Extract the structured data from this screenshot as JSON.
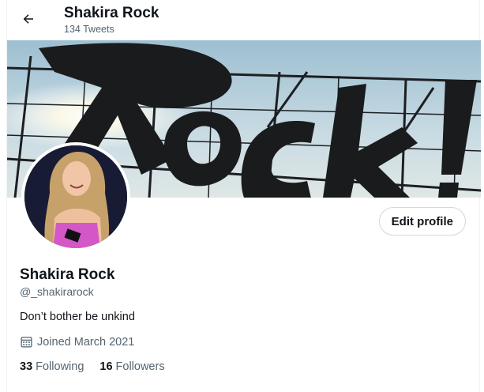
{
  "header": {
    "title": "Shakira Rock",
    "tweet_count": "134 Tweets",
    "back_icon": "arrow-left-icon"
  },
  "profile": {
    "name": "Shakira Rock",
    "handle": "@_shakirarock",
    "bio": "Don’t bother be unkind",
    "joined": "Joined March 2021",
    "following_count": "33",
    "following_label": "Following",
    "followers_count": "16",
    "followers_label": "Followers",
    "calendar_icon": "calendar-icon"
  },
  "actions": {
    "edit_profile_label": "Edit profile"
  },
  "colors": {
    "text_primary": "#0f1419",
    "text_secondary": "#536471",
    "border": "#cfd9de"
  }
}
